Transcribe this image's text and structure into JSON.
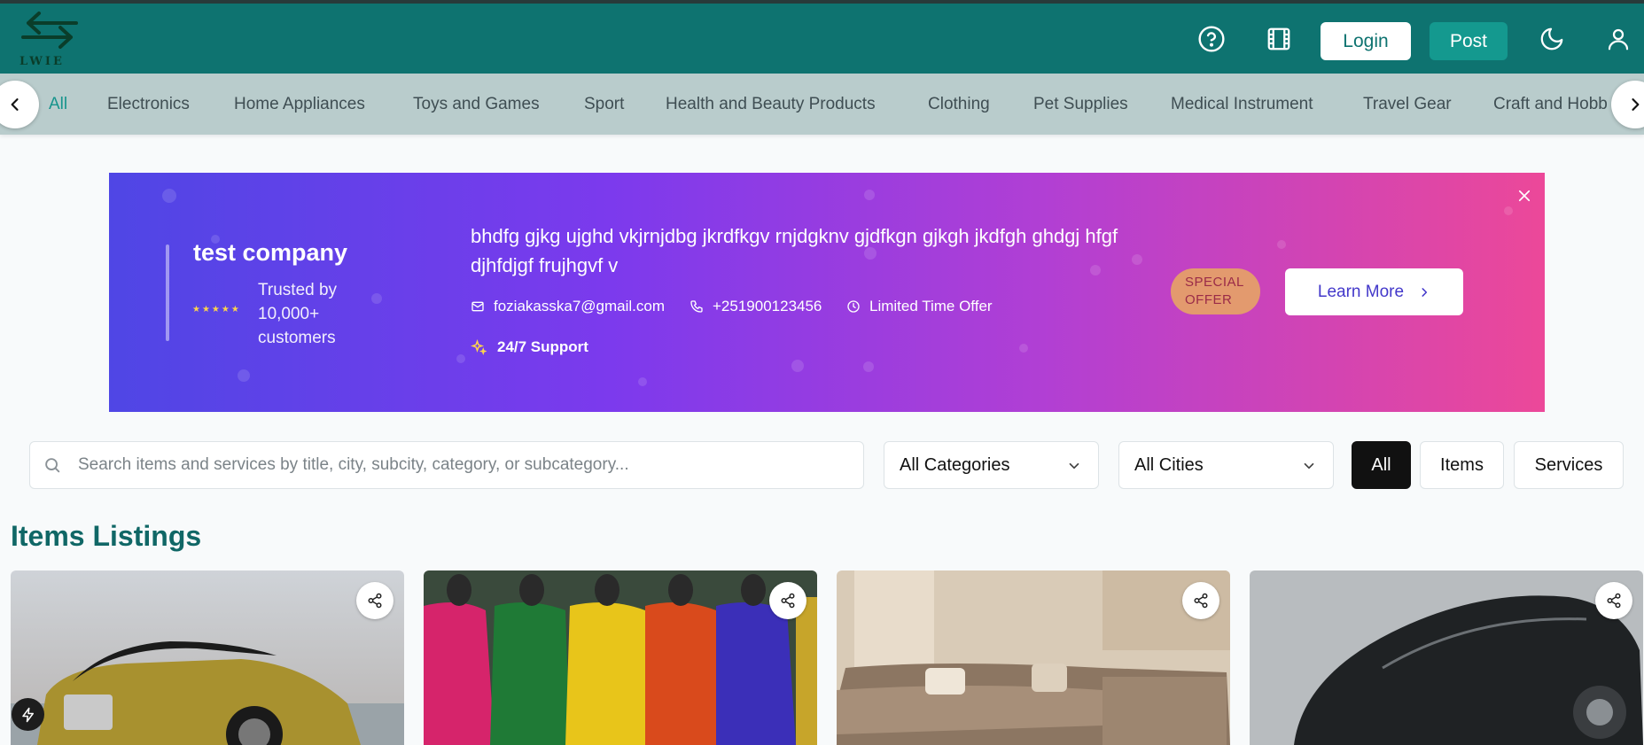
{
  "header": {
    "logo_text": "LWIE",
    "login_label": "Login",
    "post_label": "Post",
    "icons": [
      "help-circle-icon",
      "film-icon",
      "moon-icon",
      "user-icon"
    ]
  },
  "categories": {
    "items": [
      "All",
      "Electronics",
      "Home Appliances",
      "Toys and Games",
      "Sport",
      "Health and Beauty Products",
      "Clothing",
      "Pet Supplies",
      "Medical Instrument",
      "Travel Gear",
      "Craft and Hobb"
    ],
    "active": "All"
  },
  "banner": {
    "company": "test company",
    "stars": "★★★★★",
    "trusted": "Trusted by 10,000+ customers",
    "description": "bhdfg gjkg ujghd vkjrnjdbg jkrdfkgv rnjdgknv gjdfkgn gjkgh jkdfgh ghdgj hfgf djhfdjgf frujhgvf v",
    "email": "foziakasska7@gmail.com",
    "phone": "+251900123456",
    "offer": "Limited Time Offer",
    "support": "24/7 Support",
    "badge": "SPECIAL OFFER",
    "cta": "Learn More",
    "colors": {
      "start": "#4f46e5",
      "end": "#ec4899"
    }
  },
  "filters": {
    "search_placeholder": "Search items and services by title, city, subcity, category, or subcategory...",
    "category_select": "All Categories",
    "city_select": "All Cities",
    "types": [
      "All",
      "Items",
      "Services"
    ],
    "active_type": "All"
  },
  "section": {
    "title": "Items Listings"
  },
  "colors": {
    "brand": "#0e7370",
    "accent": "#14998f",
    "category_bar": "#b9cccc"
  }
}
